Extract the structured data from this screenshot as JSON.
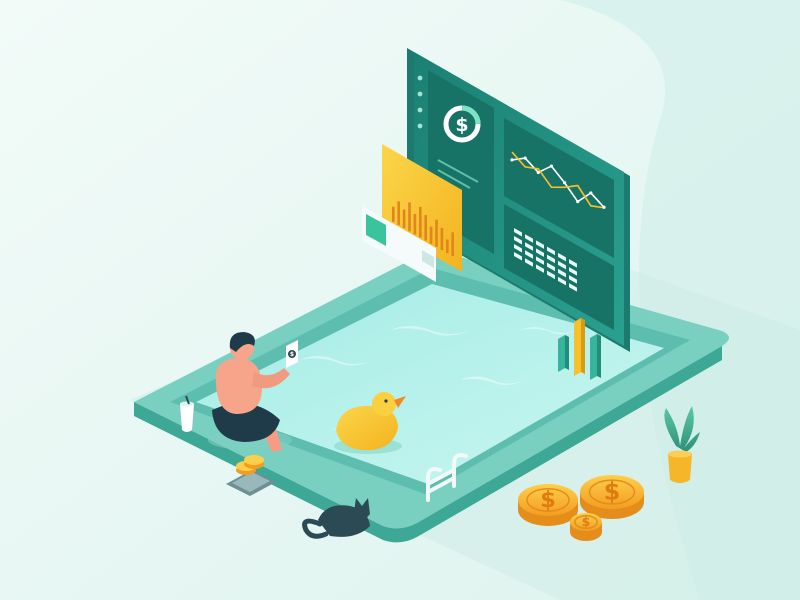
{
  "scene": {
    "kind": "isometric illustration",
    "colors": {
      "background": "#ecf8f5",
      "pool_rim": "#6cc6b6",
      "pool_water": "#aeeee9",
      "dashboard_panel": "#1f8a7d",
      "accent_yellow": "#f6c12b",
      "coin_gold": "#f2a52a",
      "skin": "#f7a58a",
      "cat": "#2c4a54"
    }
  },
  "dashboard": {
    "dollar_symbol": "$",
    "line_chart_points": [
      0.35,
      0.55,
      0.4,
      0.7,
      0.5,
      0.25,
      0.6,
      0.45
    ],
    "grid_rows": 4,
    "grid_cols": 6
  },
  "floating_bar_chart": {
    "bars": [
      0.45,
      0.7,
      0.55,
      0.85,
      0.6,
      0.9,
      0.75,
      0.5,
      0.8,
      0.65,
      0.4,
      0.7
    ]
  },
  "pool_bars": {
    "values": [
      0.55,
      0.9,
      0.7
    ]
  },
  "coins": {
    "symbol": "$",
    "count": 3
  },
  "phone": {
    "symbol": "$"
  }
}
